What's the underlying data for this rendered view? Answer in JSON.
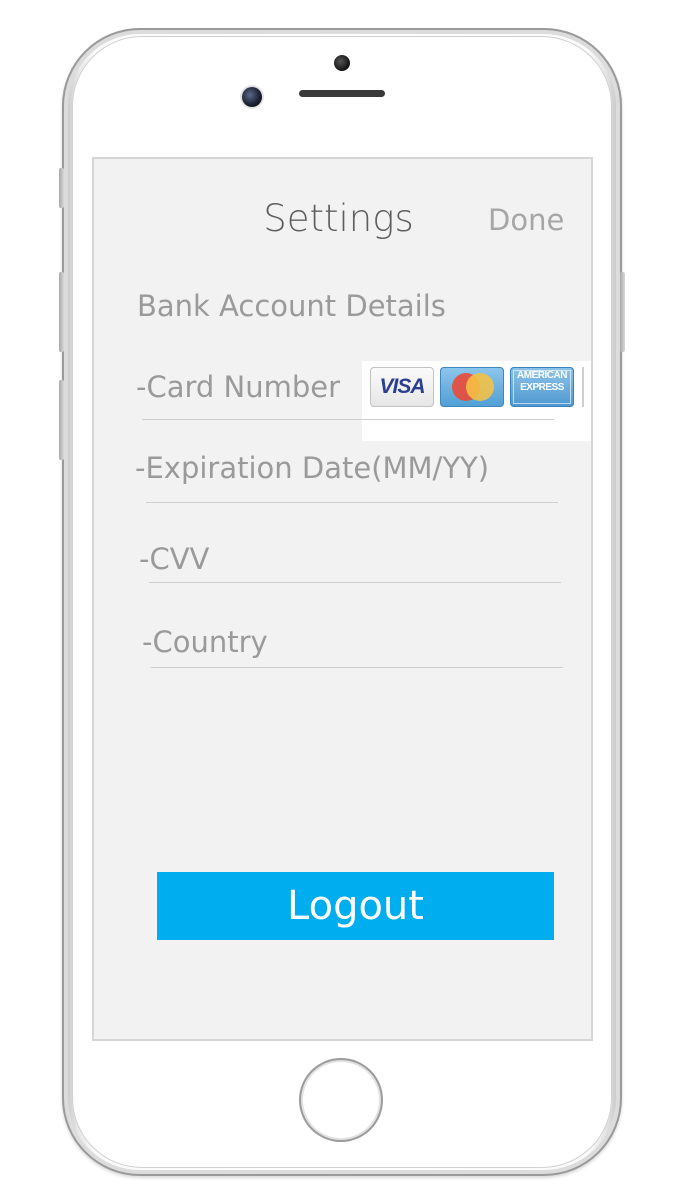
{
  "header": {
    "title": "Settings",
    "done_label": "Done"
  },
  "section": {
    "title": "Bank Account Details"
  },
  "fields": [
    {
      "label": "-Card Number"
    },
    {
      "label": "-Expiration Date(MM/YY)"
    },
    {
      "label": "-CVV"
    },
    {
      "label": "-Country"
    }
  ],
  "cards": [
    {
      "name": "VISA",
      "icon": "visa-card-icon"
    },
    {
      "name": "mastercard",
      "icon": "mastercard-card-icon"
    },
    {
      "name": "AMERICAN EXPRESS",
      "icon": "amex-card-icon"
    }
  ],
  "logout_label": "Logout",
  "colors": {
    "accent": "#00adef",
    "screen_background": "#f2f2f2",
    "label_text": "#9a9a9a",
    "title_text": "#5e5e5e"
  }
}
